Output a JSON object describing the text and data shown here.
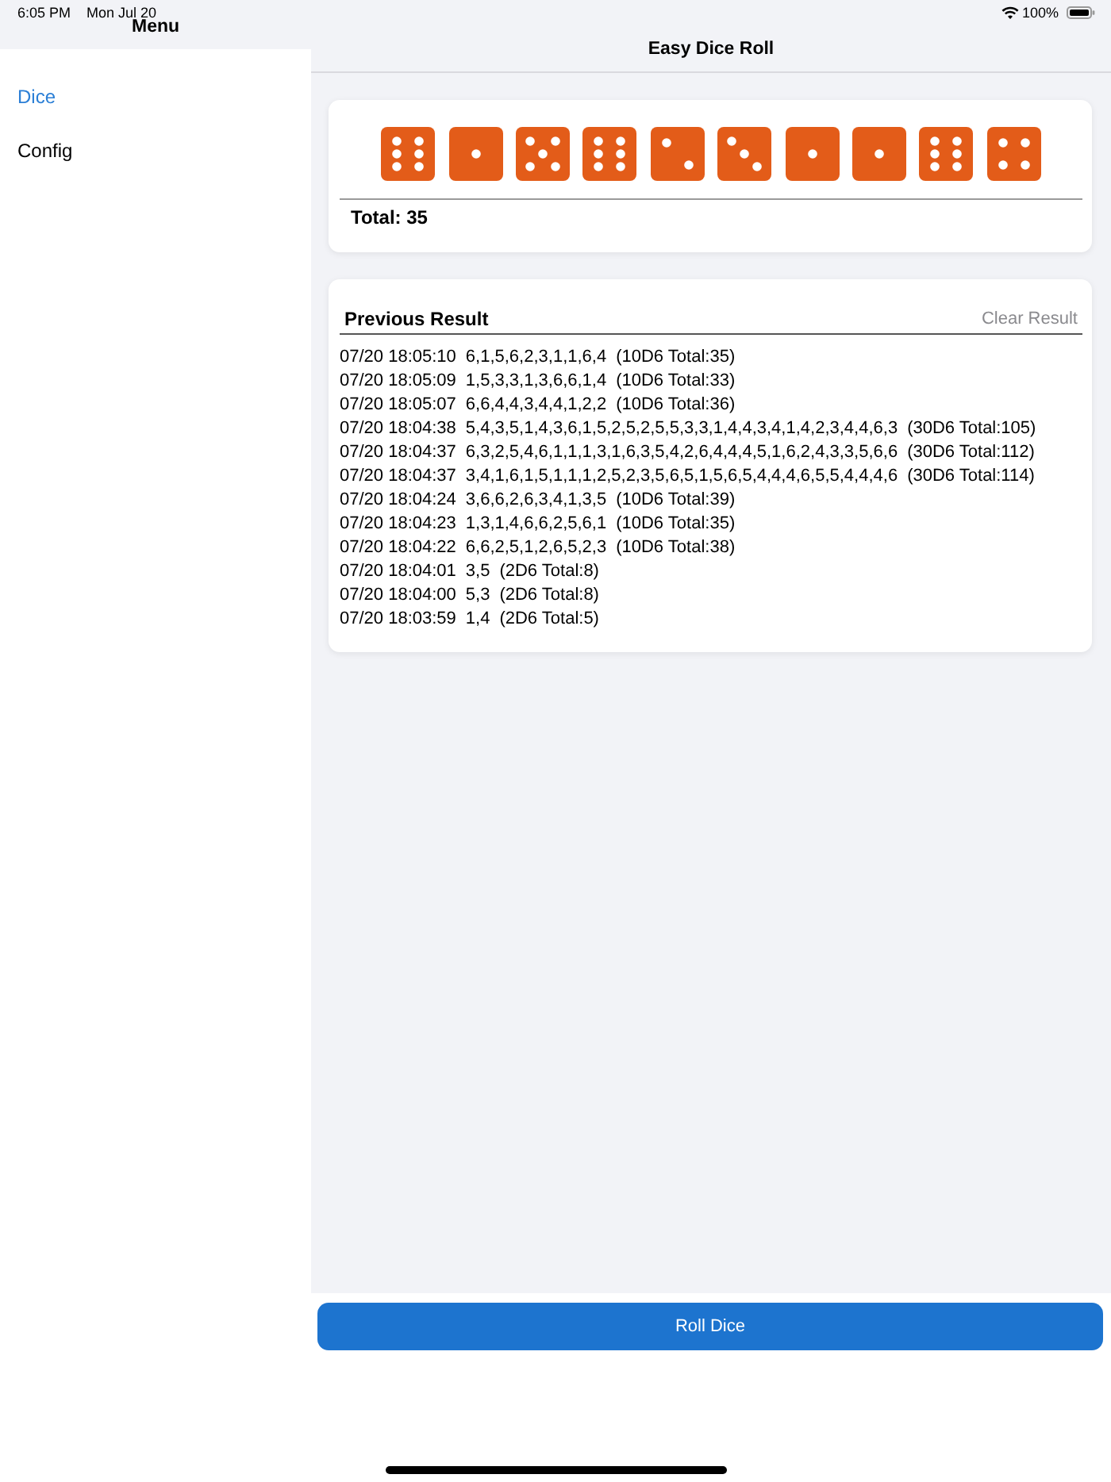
{
  "status_bar": {
    "time": "6:05 PM",
    "date": "Mon Jul 20",
    "battery": "100%"
  },
  "sidebar": {
    "title": "Menu",
    "items": [
      {
        "label": "Dice",
        "selected": true
      },
      {
        "label": "Config",
        "selected": false
      }
    ]
  },
  "nav_bar": {
    "title": "Easy Dice Roll"
  },
  "dice_card": {
    "dice": [
      {
        "kind": "six"
      },
      {
        "kind": "one"
      },
      {
        "kind": "five"
      },
      {
        "kind": "six"
      },
      {
        "kind": "two"
      },
      {
        "kind": "three"
      },
      {
        "kind": "one"
      },
      {
        "kind": "one"
      },
      {
        "kind": "six"
      },
      {
        "kind": "four"
      }
    ],
    "total": "Total: 35"
  },
  "history": {
    "title": "Previous Result",
    "clear_button": "Clear Result",
    "rows": [
      {
        "time": "07/20 18:05:10",
        "rolls": "6,1,5,6,2,3,1,1,6,4",
        "summary": "(10D6 Total:35)"
      },
      {
        "time": "07/20 18:05:09",
        "rolls": "1,5,3,3,1,3,6,6,1,4",
        "summary": "(10D6 Total:33)"
      },
      {
        "time": "07/20 18:05:07",
        "rolls": "6,6,4,4,3,4,4,1,2,2",
        "summary": "(10D6 Total:36)"
      },
      {
        "time": "07/20 18:04:38",
        "rolls": "5,4,3,5,1,4,3,6,1,5,2,5,2,5,5,3,3,1,4,4,3,4,1,4,2,3,4,4,6,3",
        "summary": "(30D6 Total:105)"
      },
      {
        "time": "07/20 18:04:37",
        "rolls": "6,3,2,5,4,6,1,1,1,3,1,6,3,5,4,2,6,4,4,4,5,1,6,2,4,3,3,5,6,6",
        "summary": "(30D6 Total:112)"
      },
      {
        "time": "07/20 18:04:37",
        "rolls": "3,4,1,6,1,5,1,1,1,2,5,2,3,5,6,5,1,5,6,5,4,4,4,6,5,5,4,4,4,6",
        "summary": "(30D6 Total:114)"
      },
      {
        "time": "07/20 18:04:24",
        "rolls": "3,6,6,2,6,3,4,1,3,5",
        "summary": "(10D6 Total:39)"
      },
      {
        "time": "07/20 18:04:23",
        "rolls": "1,3,1,4,6,6,2,5,6,1",
        "summary": "(10D6 Total:35)"
      },
      {
        "time": "07/20 18:04:22",
        "rolls": "6,6,2,5,1,2,6,5,2,3",
        "summary": "(10D6 Total:38)"
      },
      {
        "time": "07/20 18:04:01",
        "rolls": "3,5",
        "summary": "(2D6 Total:8)"
      },
      {
        "time": "07/20 18:04:00",
        "rolls": "5,3",
        "summary": "(2D6 Total:8)"
      },
      {
        "time": "07/20 18:03:59",
        "rolls": "1,4",
        "summary": "(2D6 Total:5)"
      }
    ]
  },
  "roll_button": "Roll Dice"
}
